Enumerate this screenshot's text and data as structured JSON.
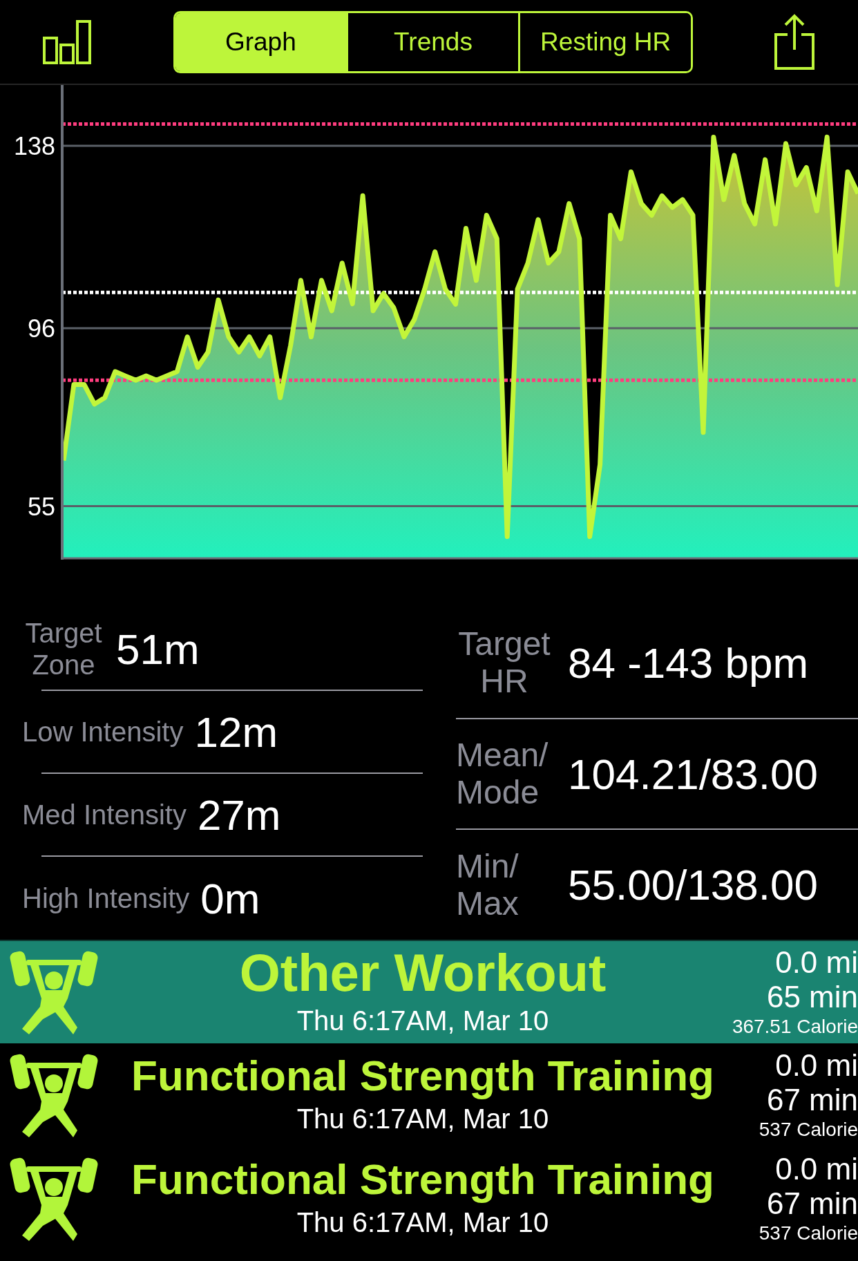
{
  "toolbar": {
    "tabs": [
      {
        "label": "Graph",
        "selected": true
      },
      {
        "label": "Trends",
        "selected": false
      },
      {
        "label": "Resting HR",
        "selected": false
      }
    ]
  },
  "chart": {
    "chart_data": {
      "type": "area",
      "ylim": [
        43,
        152
      ],
      "yticks": [
        55,
        96,
        138
      ],
      "grid": true,
      "series": [
        {
          "color": "#c2f53a",
          "values": [
            65.5,
            83,
            83,
            78.5,
            80,
            86,
            85,
            84,
            85,
            84,
            85,
            86,
            94,
            87,
            90.5,
            102.5,
            94,
            90.5,
            94,
            89.6,
            94,
            80,
            92,
            107,
            94,
            107,
            100,
            111,
            101.6,
            126.5,
            100,
            104,
            100.7,
            94,
            98,
            105,
            113.6,
            105,
            101.5,
            119,
            107,
            122,
            116.6,
            48,
            105,
            111,
            121,
            111,
            113.6,
            124.7,
            116.6,
            48,
            64.6,
            122,
            116.6,
            132,
            124.7,
            122,
            126.5,
            123.8,
            125.6,
            122,
            72,
            140,
            125.6,
            135.8,
            124.7,
            120,
            134.8,
            120,
            138.5,
            129,
            133,
            123,
            140,
            106,
            132,
            127
          ]
        }
      ],
      "ref_lines": [
        {
          "axis": "y",
          "value": 143,
          "color": "#ff3d7f"
        },
        {
          "axis": "y",
          "value": 104.21,
          "color": "#ffffff"
        },
        {
          "axis": "y",
          "value": 84,
          "color": "#ff3d7f"
        }
      ]
    }
  },
  "stats": {
    "left": [
      {
        "label": "Target Zone",
        "value": "51m"
      },
      {
        "label": "Low Intensity",
        "value": "12m"
      },
      {
        "label": "Med Intensity",
        "value": "27m"
      },
      {
        "label": "High Intensity",
        "value": "0m"
      }
    ],
    "right": [
      {
        "label": "Target HR",
        "value": "84 -143 bpm"
      },
      {
        "label": "Mean/ Mode",
        "value": "104.21/83.00"
      },
      {
        "label": "Min/ Max",
        "value": "55.00/138.00"
      }
    ]
  },
  "workouts": [
    {
      "title": "Other Workout",
      "date": "Thu 6:17AM, Mar 10",
      "distance": "0.0 mi",
      "duration": "65 min",
      "calories": "367.51 Calorie",
      "selected": true
    },
    {
      "title": "Functional Strength Training",
      "date": "Thu 6:17AM, Mar 10",
      "distance": "0.0 mi",
      "duration": "67 min",
      "calories": "537 Calorie",
      "selected": false
    },
    {
      "title": "Functional Strength Training",
      "date": "Thu 6:17AM, Mar 10",
      "distance": "0.0 mi",
      "duration": "67 min",
      "calories": "537 Calorie",
      "selected": false
    }
  ]
}
